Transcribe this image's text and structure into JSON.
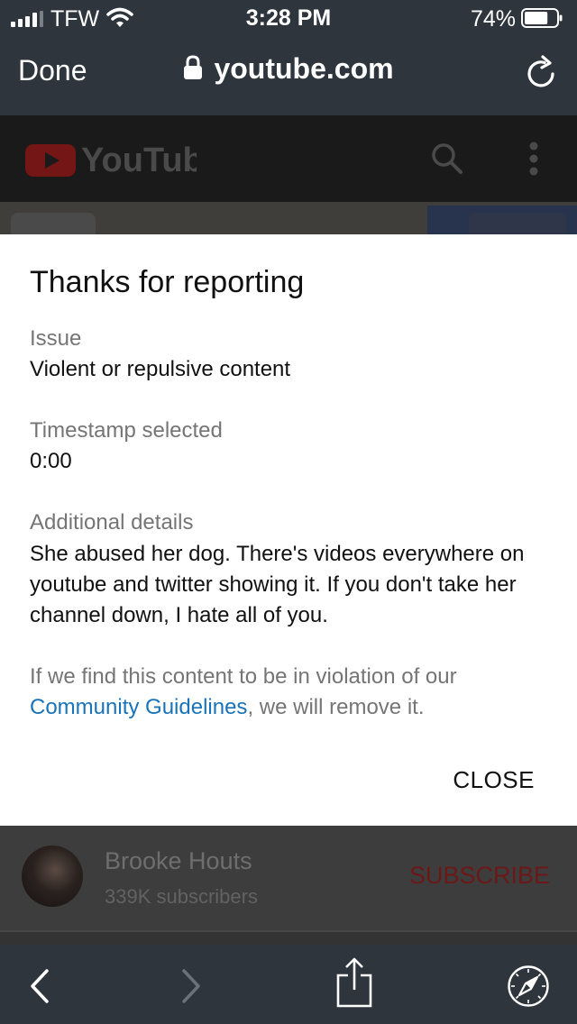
{
  "status_bar": {
    "carrier": "TFW",
    "time": "3:28 PM",
    "battery_percent": "74%",
    "battery_level": 0.74,
    "icons": [
      "signal-icon",
      "wifi-icon",
      "battery-icon"
    ]
  },
  "browser": {
    "done_label": "Done",
    "url": "youtube.com",
    "icons": [
      "lock-icon",
      "reload-icon"
    ]
  },
  "youtube_header": {
    "logo_text": "YouTube",
    "icons": [
      "search-icon",
      "more-vert-icon"
    ]
  },
  "dialog": {
    "title": "Thanks for reporting",
    "issue_label": "Issue",
    "issue_value": "Violent or repulsive content",
    "timestamp_label": "Timestamp selected",
    "timestamp_value": "0:00",
    "details_label": "Additional details",
    "details_value": "She abused her dog. There's videos everywhere on youtube and twitter showing it. If you don't take her channel down, I hate all of you.",
    "notice_prefix": "If we find this content to be in violation of our",
    "notice_link": "Community Guidelines",
    "notice_suffix": ", we will remove it.",
    "close_label": "CLOSE"
  },
  "channel": {
    "name": "Brooke Houts",
    "subscribers": "339K subscribers",
    "subscribe_label": "SUBSCRIBE"
  },
  "toolbar": {
    "icons": [
      "back-icon",
      "forward-icon",
      "share-icon",
      "compass-icon"
    ]
  },
  "colors": {
    "browser_chrome": "#2e353d",
    "dialog_bg": "#ffffff",
    "link": "#1a73b8",
    "youtube_red": "#d62320",
    "muted_text": "#757575"
  }
}
